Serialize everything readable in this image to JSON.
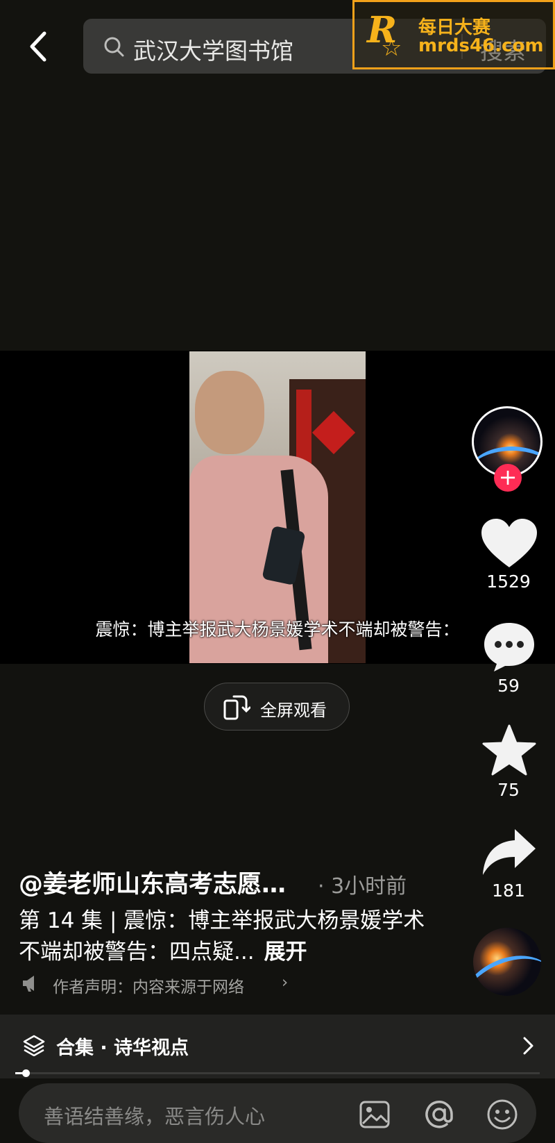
{
  "header": {
    "back_label": "",
    "search_query": "武汉大学图书馆",
    "search_button": "搜索"
  },
  "watermark": {
    "logo": "R",
    "line1": "每日大赛",
    "line2": "mrds46.com"
  },
  "video": {
    "subtitle": "震惊：博主举报武大杨景媛学术不端却被警告：",
    "fullscreen_label": "全屏观看"
  },
  "rail": {
    "likes": "1529",
    "comments": "59",
    "favorites": "75",
    "shares": "181",
    "follow_symbol": "+"
  },
  "post": {
    "author": "@姜老师山东高考志愿…",
    "time": "· 3小时前",
    "description": "第 14 集 | 震惊：博主举报武大杨景媛学术不端却被警告：四点疑...",
    "expand": "展开",
    "declaration": "作者声明：内容来源于网络",
    "declaration_chevron": "›"
  },
  "collection": {
    "label": "合集 · 诗华视点"
  },
  "progress": {
    "fraction": 0.02
  },
  "comment": {
    "placeholder": "善语结善缘，恶言伤人心"
  },
  "colors": {
    "accent": "#fe2c55",
    "watermark": "#f6b21b",
    "background": "#12120f"
  },
  "icons": [
    "back-icon",
    "search-icon",
    "heart-icon",
    "comment-icon",
    "star-icon",
    "share-icon",
    "rotate-screen-icon",
    "megaphone-icon",
    "layers-icon",
    "chevron-right-icon",
    "image-icon",
    "at-icon",
    "emoji-icon"
  ]
}
